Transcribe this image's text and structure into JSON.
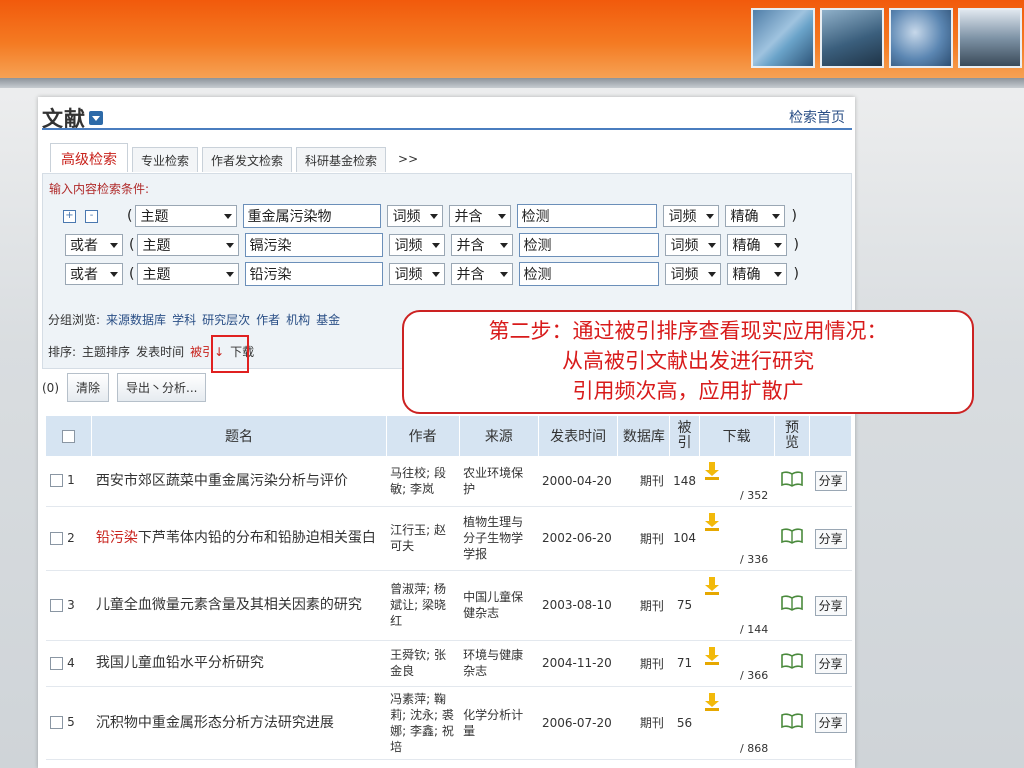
{
  "panel": {
    "title": "文献",
    "home_link": "检索首页"
  },
  "tabs": [
    {
      "label": "高级检索",
      "active": true
    },
    {
      "label": "专业检索"
    },
    {
      "label": "作者发文检索"
    },
    {
      "label": "科研基金检索"
    },
    {
      "label": ">>"
    }
  ],
  "search": {
    "condition_label": "输入内容检索条件:",
    "rows": [
      {
        "logic": "",
        "field": "主题",
        "term": "重金属污染物",
        "freq1": "词频",
        "op": "并含",
        "term2": "检测",
        "freq2": "词频",
        "match": "精确"
      },
      {
        "logic": "或者",
        "field": "主题",
        "term": "镉污染",
        "freq1": "词频",
        "op": "并含",
        "term2": "检测",
        "freq2": "词频",
        "match": "精确"
      },
      {
        "logic": "或者",
        "field": "主题",
        "term": "铅污染",
        "freq1": "词频",
        "op": "并含",
        "term2": "检测",
        "freq2": "词频",
        "match": "精确"
      }
    ],
    "paren_open": "(",
    "paren_close": ")",
    "plus": "+",
    "minus": "-"
  },
  "group": {
    "label": "分组浏览:",
    "items": [
      "来源数据库",
      "学科",
      "研究层次",
      "作者",
      "机构",
      "基金"
    ]
  },
  "sort": {
    "label": "排序:",
    "items": [
      "主题排序",
      "发表时间",
      "被引↓",
      "下载"
    ]
  },
  "actions": {
    "count": "(0)",
    "clear": "清除",
    "export": "导出丶分析..."
  },
  "table": {
    "headers": [
      "题名",
      "作者",
      "来源",
      "发表时间",
      "数据库",
      "被引",
      "下载",
      "预览"
    ],
    "cite_header": [
      "被",
      "引"
    ],
    "preview_header": [
      "预",
      "览"
    ],
    "share_label": "分享",
    "rows": [
      {
        "idx": "1",
        "title_hl": "",
        "title": "西安市郊区蔬菜中重金属污染分析与评价",
        "author": "马往校; 段敏; 李岚",
        "source": "农业环境保护",
        "date": "2000-04-20",
        "db": "期刊",
        "cite": "148",
        "dl": "/ 352"
      },
      {
        "idx": "2",
        "title_hl": "铅污染",
        "title": "下芦苇体内铅的分布和铅胁迫相关蛋白",
        "author": "江行玉; 赵可夫",
        "source": "植物生理与分子生物学学报",
        "date": "2002-06-20",
        "db": "期刊",
        "cite": "104",
        "dl": "/ 336"
      },
      {
        "idx": "3",
        "title_hl": "",
        "title": "儿童全血微量元素含量及其相关因素的研究",
        "author": "曾淑萍; 杨斌让; 梁晓红",
        "source": "中国儿童保健杂志",
        "date": "2003-08-10",
        "db": "期刊",
        "cite": "75",
        "dl": "/ 144"
      },
      {
        "idx": "4",
        "title_hl": "",
        "title": "我国儿童血铅水平分析研究",
        "author": "王舜钦; 张金良",
        "source": "环境与健康杂志",
        "date": "2004-11-20",
        "db": "期刊",
        "cite": "71",
        "dl": "/ 366"
      },
      {
        "idx": "5",
        "title_hl": "",
        "title": "沉积物中重金属形态分析方法研究进展",
        "author": "冯素萍; 鞠莉; 沈永; 裘娜; 李鑫; 祝培",
        "source": "化学分析计量",
        "date": "2006-07-20",
        "db": "期刊",
        "cite": "56",
        "dl": "/ 868"
      }
    ]
  },
  "callout": {
    "line1": "第二步：通过被引排序查看现实应用情况：",
    "line2": "从高被引文献出发进行研究",
    "line3": "引用频次高，应用扩散广"
  },
  "colors": {
    "accent": "#f47a22",
    "link": "#2a4f86",
    "highlight": "#c8211b",
    "header_bg": "#d6e4f2"
  }
}
